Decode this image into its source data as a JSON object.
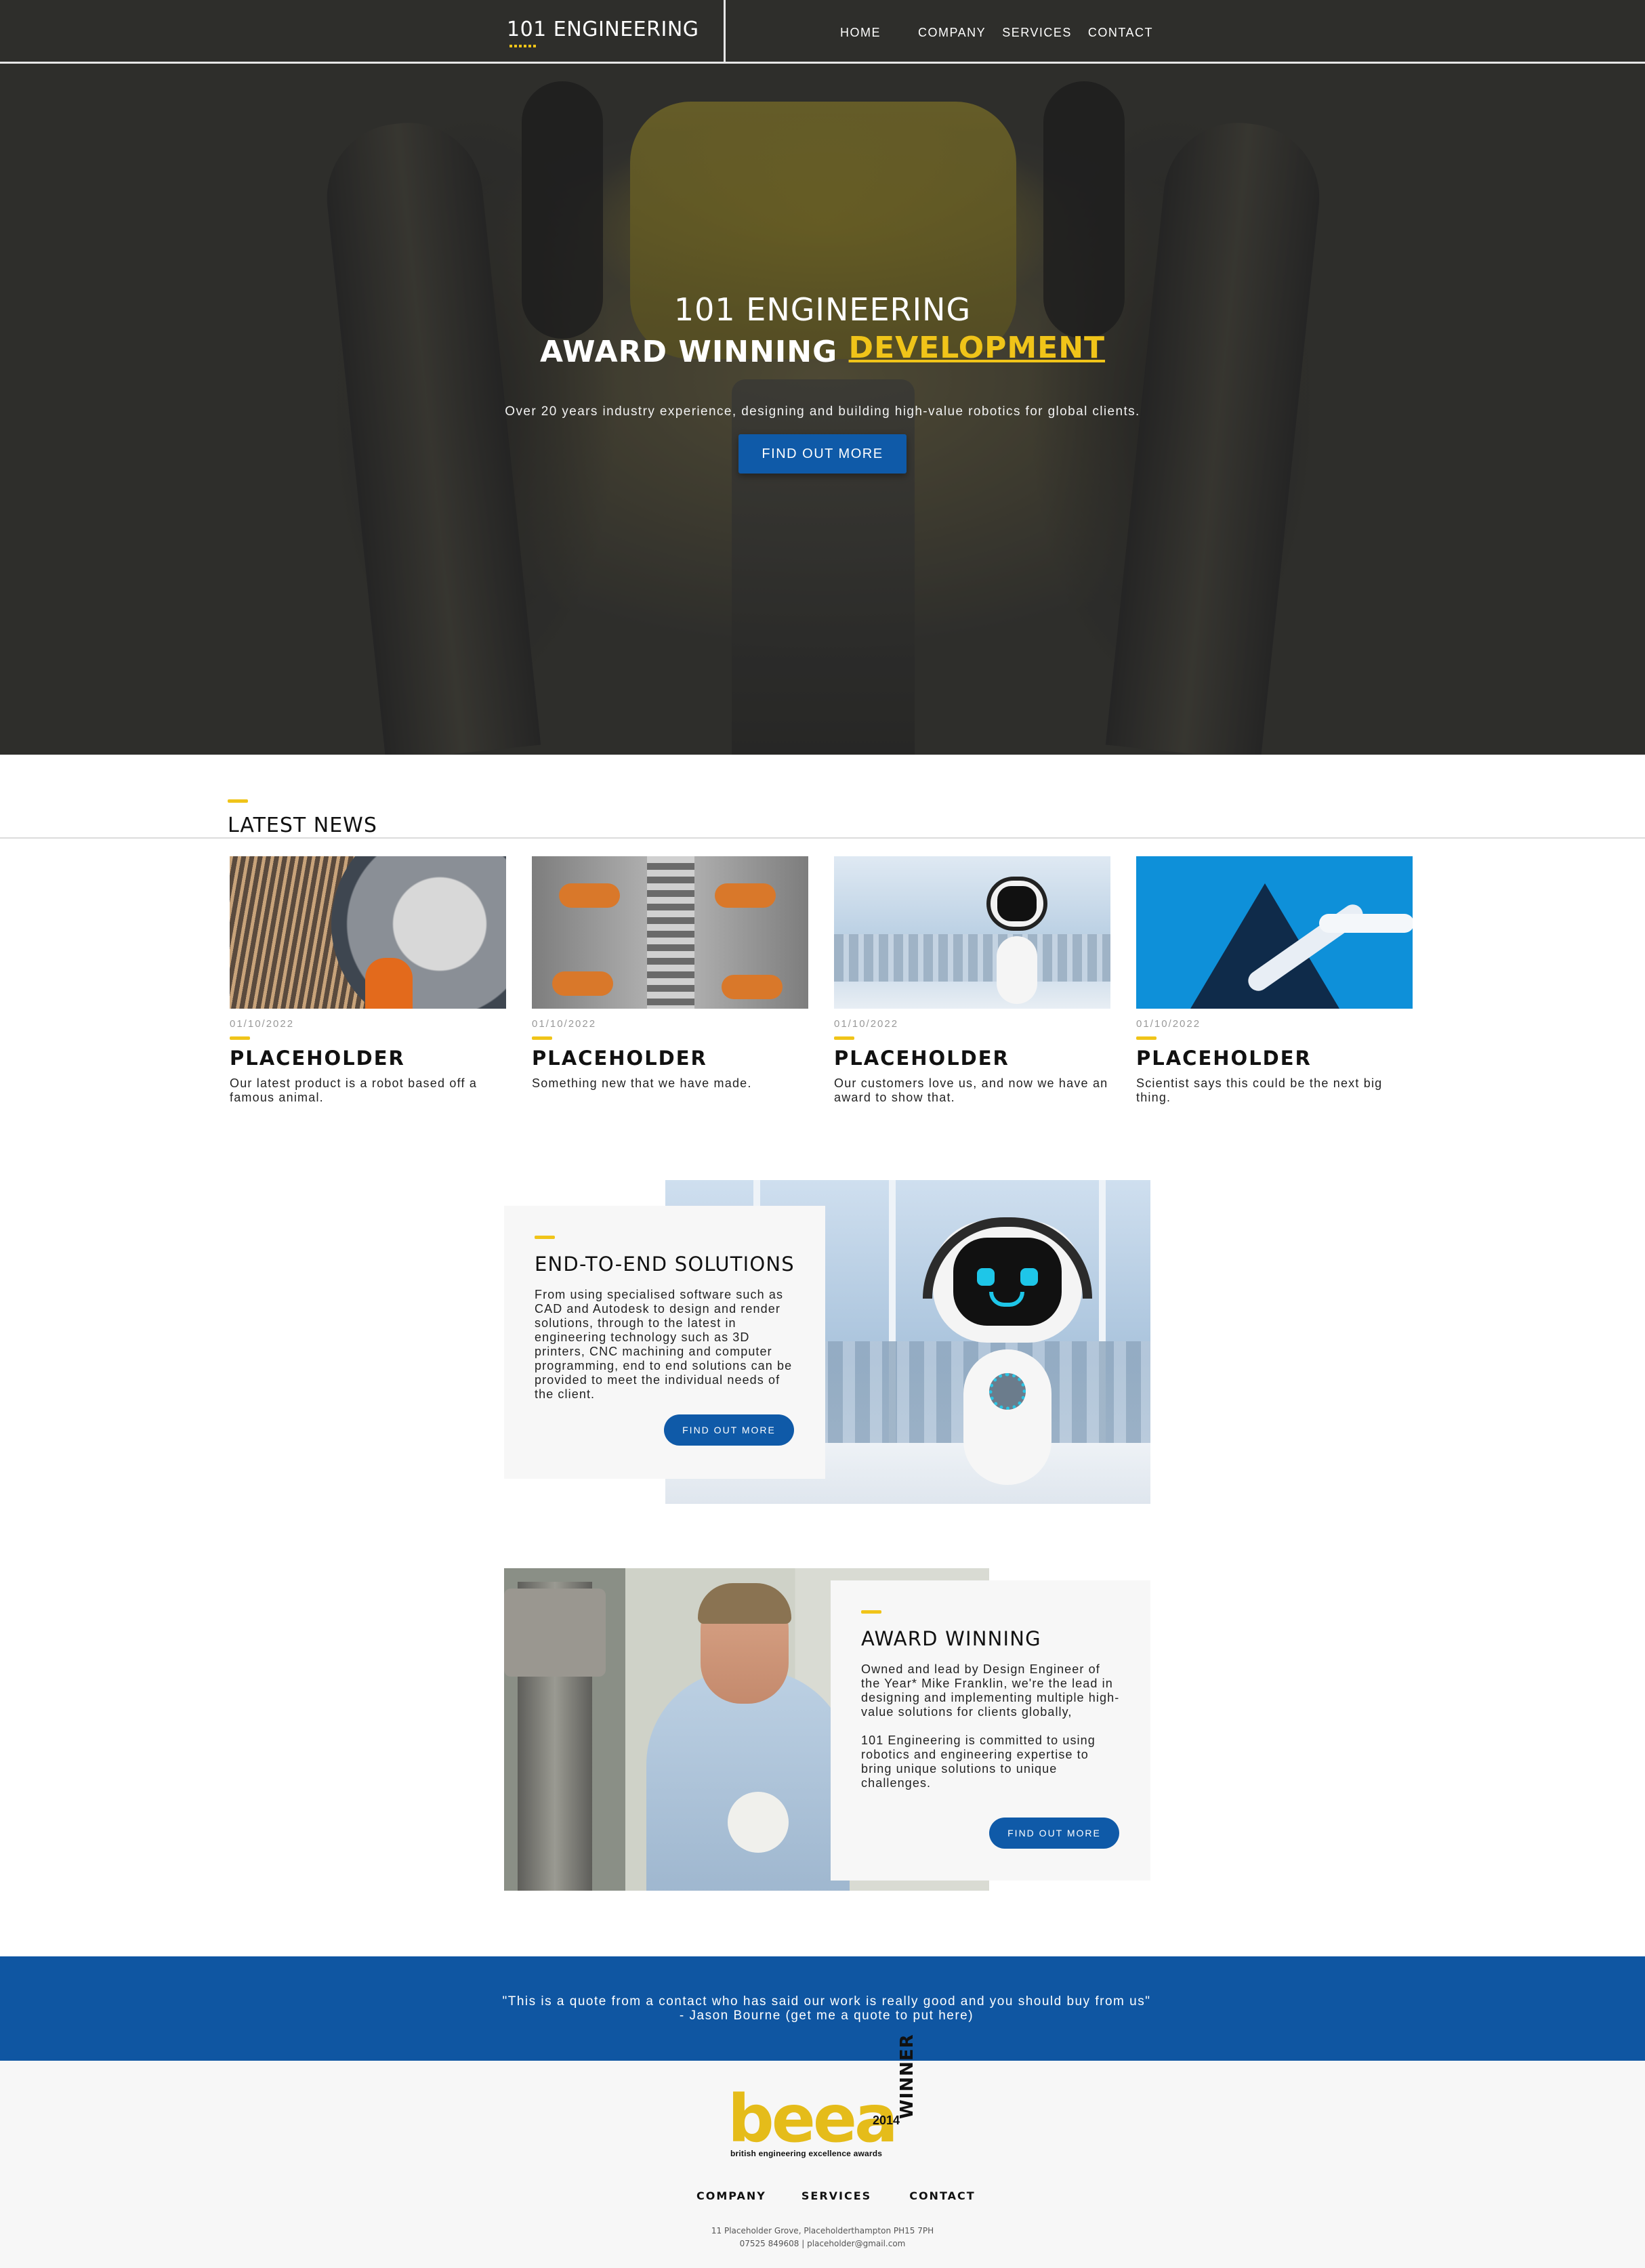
{
  "nav": {
    "brand": "101 ENGINEERING",
    "links": [
      "HOME",
      "COMPANY",
      "SERVICES",
      "CONTACT"
    ]
  },
  "hero": {
    "title": "101 ENGINEERING",
    "headline_lead": "AWARD WINNING",
    "headline_highlight": "DEVELOPMENT",
    "subtitle": "Over 20 years industry experience, designing and building high-value robotics for global clients.",
    "cta": "FIND OUT MORE"
  },
  "news": {
    "heading": "LATEST NEWS",
    "items": [
      {
        "date": "01/10/2022",
        "title": "PLACEHOLDER",
        "desc": "Our latest product is a robot based off a famous animal.",
        "image": "turbine-engineers-photo"
      },
      {
        "date": "01/10/2022",
        "title": "PLACEHOLDER",
        "desc": "Something new that we have made.",
        "image": "robot-arms-assembly-photo"
      },
      {
        "date": "01/10/2022",
        "title": "PLACEHOLDER",
        "desc": "Our customers love us, and now we have an award to show that.",
        "image": "assistant-robot-photo"
      },
      {
        "date": "01/10/2022",
        "title": "PLACEHOLDER",
        "desc": "Scientist says this could be the next big thing.",
        "image": "robotic-arm-lab-photo"
      }
    ]
  },
  "solutions": {
    "title": "END-TO-END SOLUTIONS",
    "body": "From using specialised software such as CAD and Autodesk to design and render solutions, through to the latest in engineering technology such as 3D printers, CNC machining and computer programming, end to end solutions can be provided to meet the individual needs of the client.",
    "cta": "FIND OUT MORE"
  },
  "award": {
    "title": "AWARD WINNING",
    "body_1": "Owned and lead by Design Engineer of the Year* Mike Franklin, we're the lead in designing and implementing multiple high-value solutions for clients globally,",
    "body_2": "101 Engineering is committed to using robotics and engineering expertise to bring unique solutions to unique challenges.",
    "cta": "FIND OUT MORE"
  },
  "quote": {
    "text": "\"This is a quote from a contact who has said our work is really good and you should buy from us\" - Jason Bourne (get me a quote to put here)"
  },
  "footer": {
    "logo": {
      "word": "beea",
      "year": "2014",
      "winner": "WINNER",
      "tagline": "british engineering excellence awards"
    },
    "links": [
      "COMPANY",
      "SERVICES",
      "CONTACT"
    ],
    "address": "11 Placeholder Grove, Placeholderthampton PH15 7PH",
    "contact": "07525 849608 | placeholder@gmail.com"
  },
  "colors": {
    "accent": "#f0c419",
    "brand_blue": "#0f5aa8",
    "quote_band": "#0f56a2"
  }
}
